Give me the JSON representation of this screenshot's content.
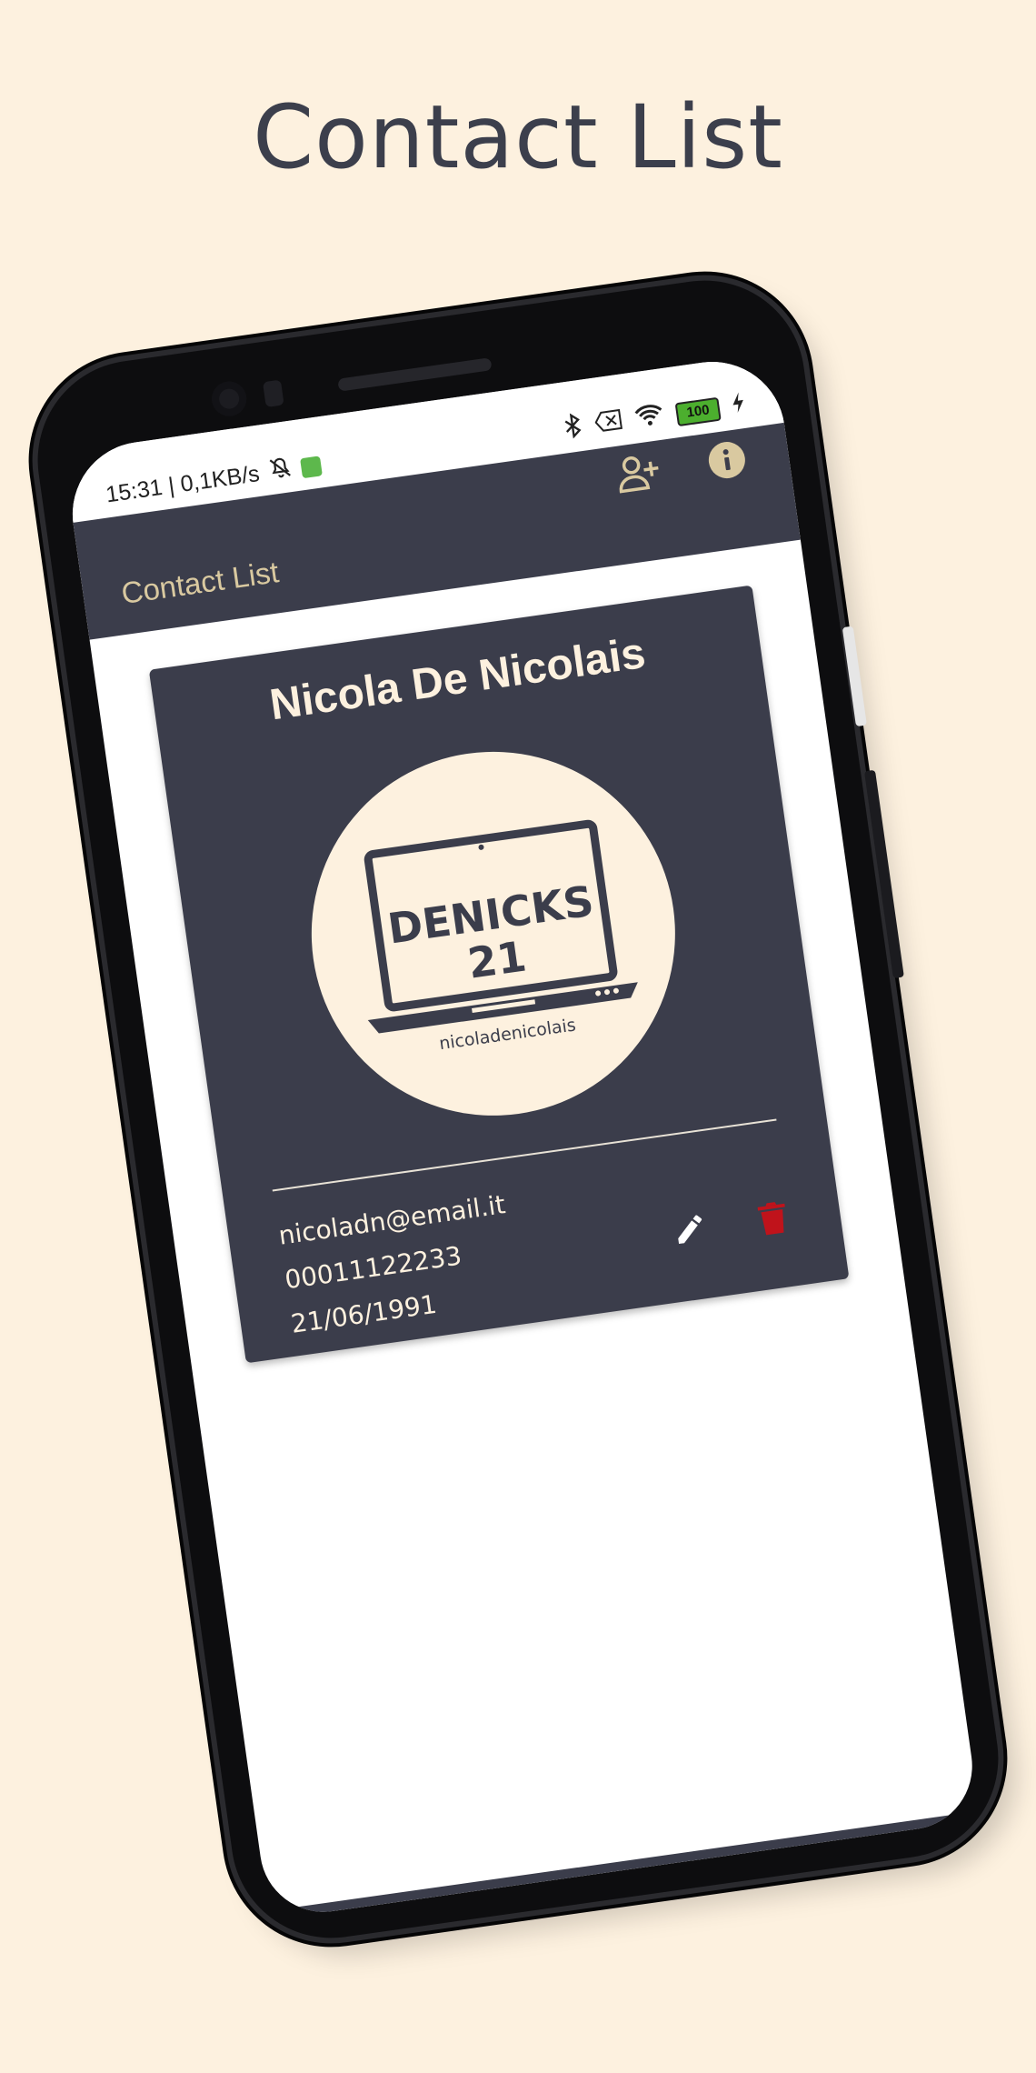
{
  "promo": {
    "title": "Contact List"
  },
  "status_bar": {
    "time_speed": "15:31 | 0,1KB/s",
    "battery": "100"
  },
  "app_bar": {
    "title": "Contact List",
    "icons": [
      "add-contact-icon",
      "info-icon"
    ]
  },
  "contact": {
    "name": "Nicola De Nicolais",
    "avatar": {
      "logo_line1": "DENICKS",
      "logo_line2": "21",
      "logo_caption": "nicoladenicolais"
    },
    "email": "nicoladn@email.it",
    "phone": "00011122233",
    "birthdate": "21/06/1991"
  },
  "colors": {
    "background": "#fdf1df",
    "primary_dark": "#3b3d4b",
    "accent_gold": "#d9c9a0",
    "delete_red": "#c0131b"
  }
}
